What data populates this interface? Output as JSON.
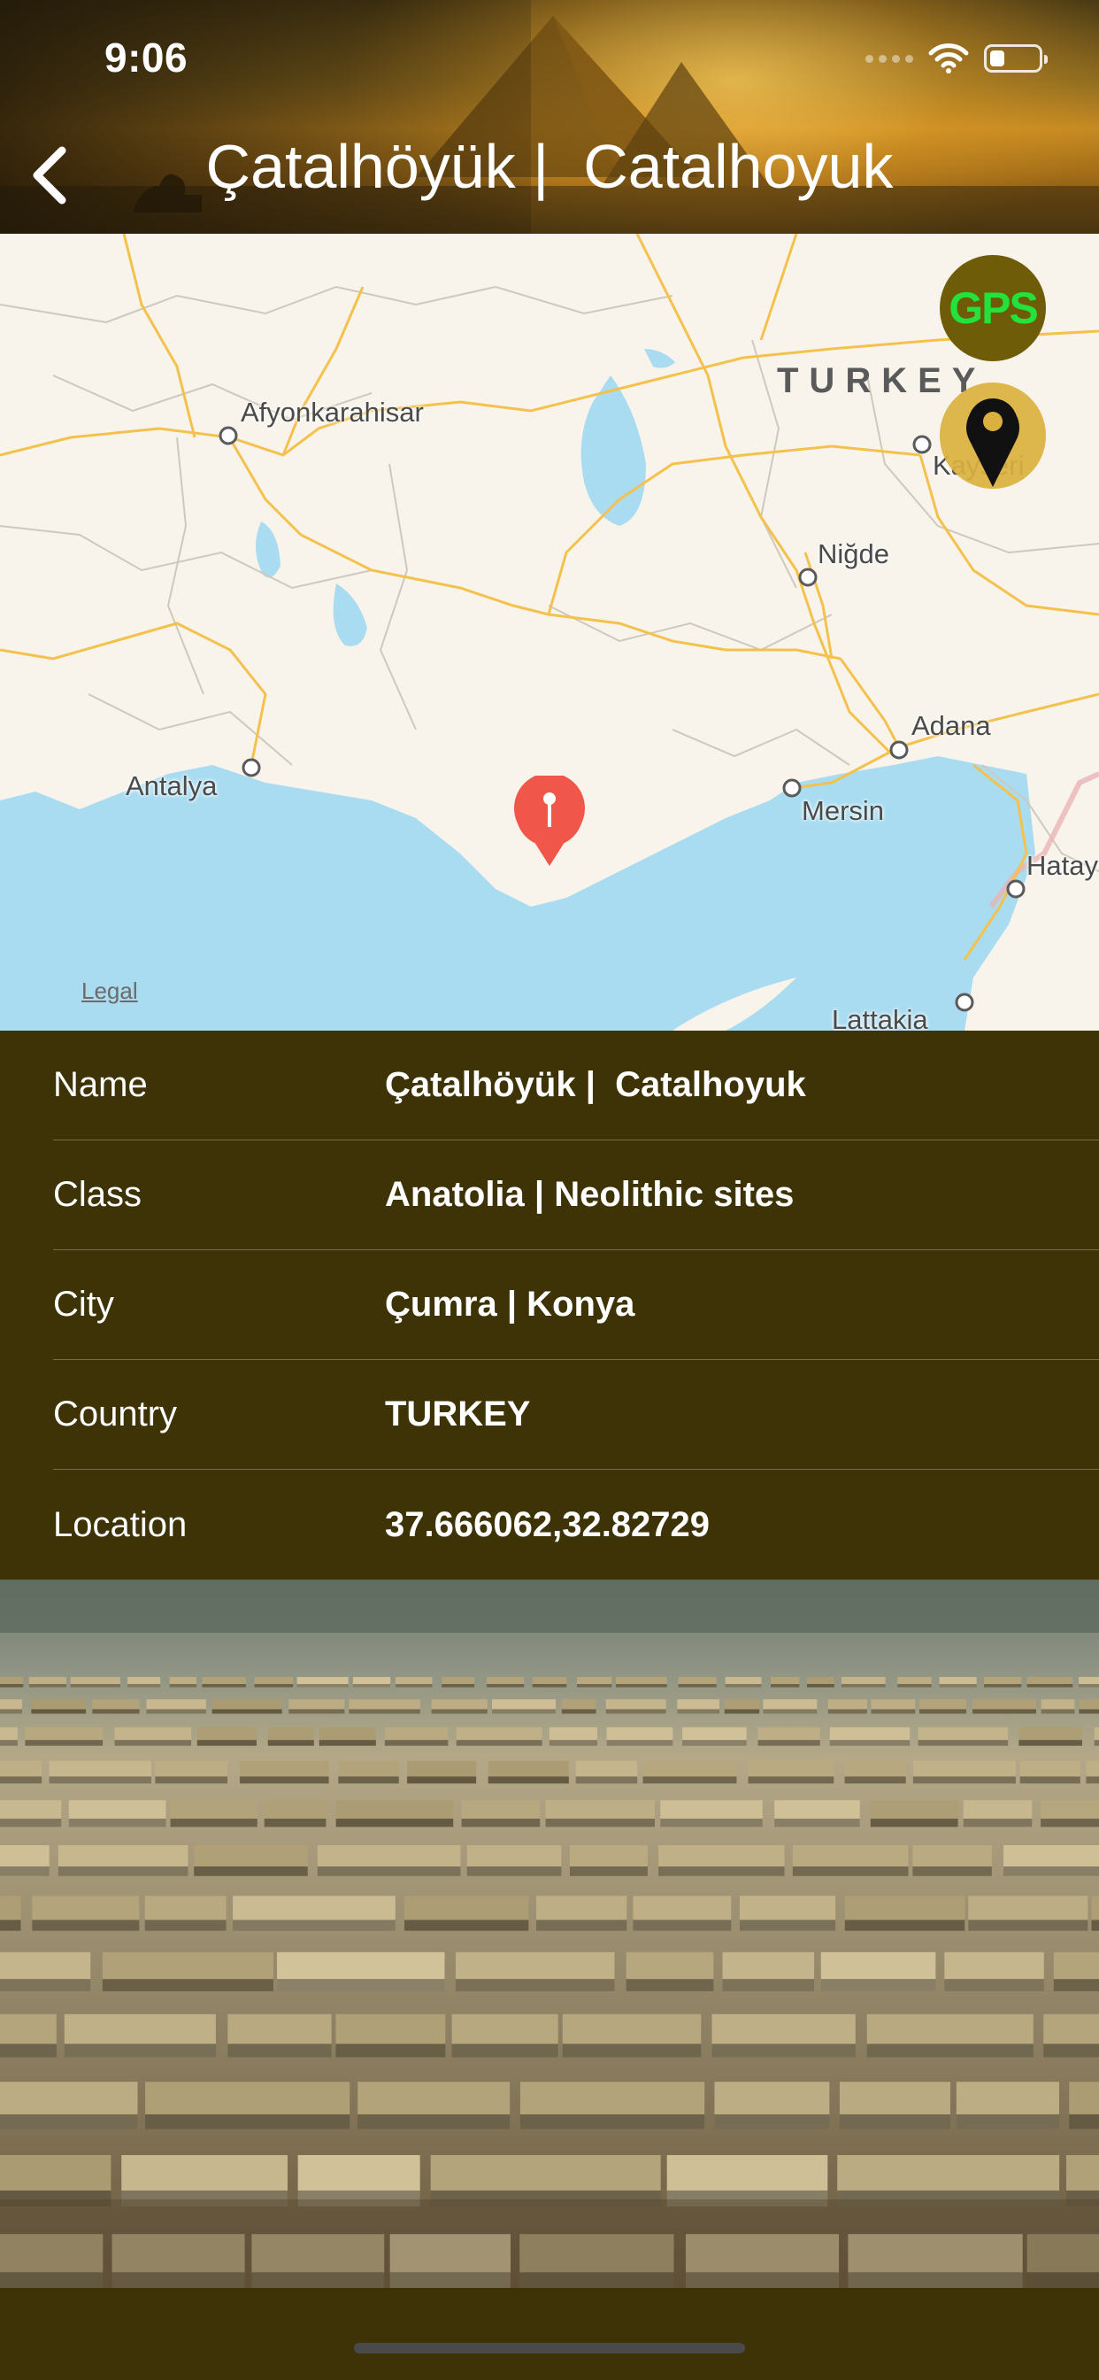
{
  "status_bar": {
    "time": "9:06",
    "battery_level": 0.3
  },
  "header": {
    "title": "Çatalhöyük |  Catalhoyuk",
    "back_icon": "chevron-left-icon"
  },
  "map": {
    "country_label": "TURKEY",
    "city_labels": [
      "Afyonkarahisar",
      "Niğde",
      "Kayseri",
      "Adana",
      "Mersin",
      "Antalya",
      "Hatay",
      "Lattakia"
    ],
    "legal": "Legal",
    "gps_button_label": "GPS",
    "gps_button_color": "#22e23b",
    "pin_color": "#f0564a",
    "location_button_icon": "map-marker-icon"
  },
  "details": {
    "rows": [
      {
        "label": "Name",
        "value": "Çatalhöyük |  Catalhoyuk"
      },
      {
        "label": "Class",
        "value": "Anatolia | Neolithic sites"
      },
      {
        "label": "City",
        "value": "Çumra | Konya"
      },
      {
        "label": "Country",
        "value": "TURKEY"
      },
      {
        "label": "Location",
        "value": "37.666062,32.82729"
      }
    ]
  },
  "colors": {
    "panel_background": "#3d3306",
    "water": "#a9dcf1",
    "land": "#f8f4ec",
    "roads": "#f4c24c"
  }
}
